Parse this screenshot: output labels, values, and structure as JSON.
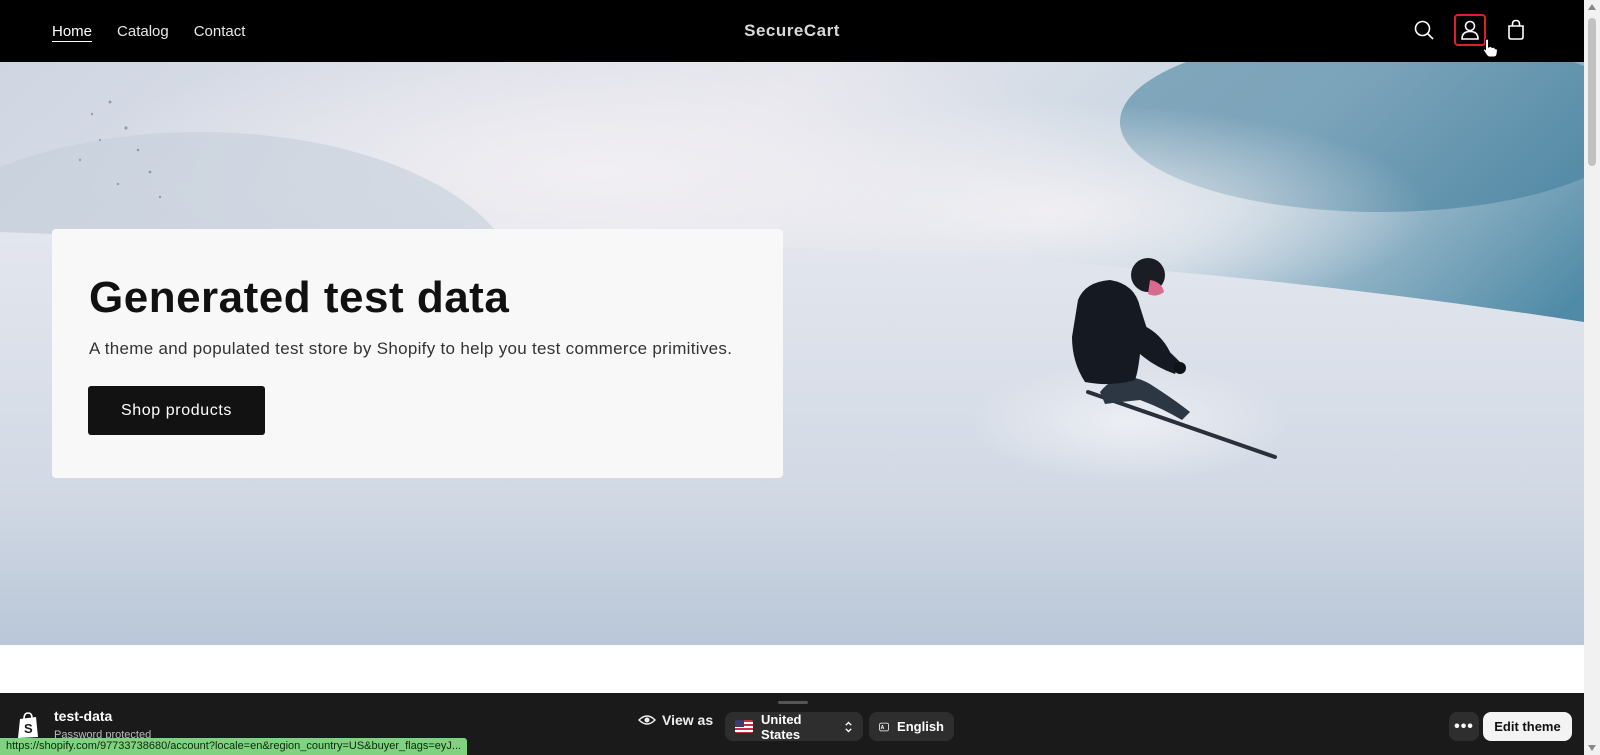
{
  "header": {
    "nav": [
      {
        "label": "Home",
        "active": true
      },
      {
        "label": "Catalog",
        "active": false
      },
      {
        "label": "Contact",
        "active": false
      }
    ],
    "brand": "SecureCart",
    "icons": [
      "search-icon",
      "account-icon",
      "cart-icon"
    ]
  },
  "hero": {
    "title": "Generated test data",
    "description": "A theme and populated test store by Shopify to help you test commerce primitives.",
    "button_label": "Shop products"
  },
  "admin_bar": {
    "store_name": "test-data",
    "store_status": "Password protected",
    "view_as_label": "View as",
    "country": "United States",
    "language": "English",
    "more_label": "•••",
    "edit_theme_label": "Edit theme"
  },
  "status_url": "https://shopify.com/97733738680/account?locale=en&region_country=US&buyer_flags=eyJ...",
  "colors": {
    "header_bg": "#000000",
    "account_highlight": "#e11d2e",
    "button_bg": "#121212",
    "status_bg": "#7fd27f"
  }
}
